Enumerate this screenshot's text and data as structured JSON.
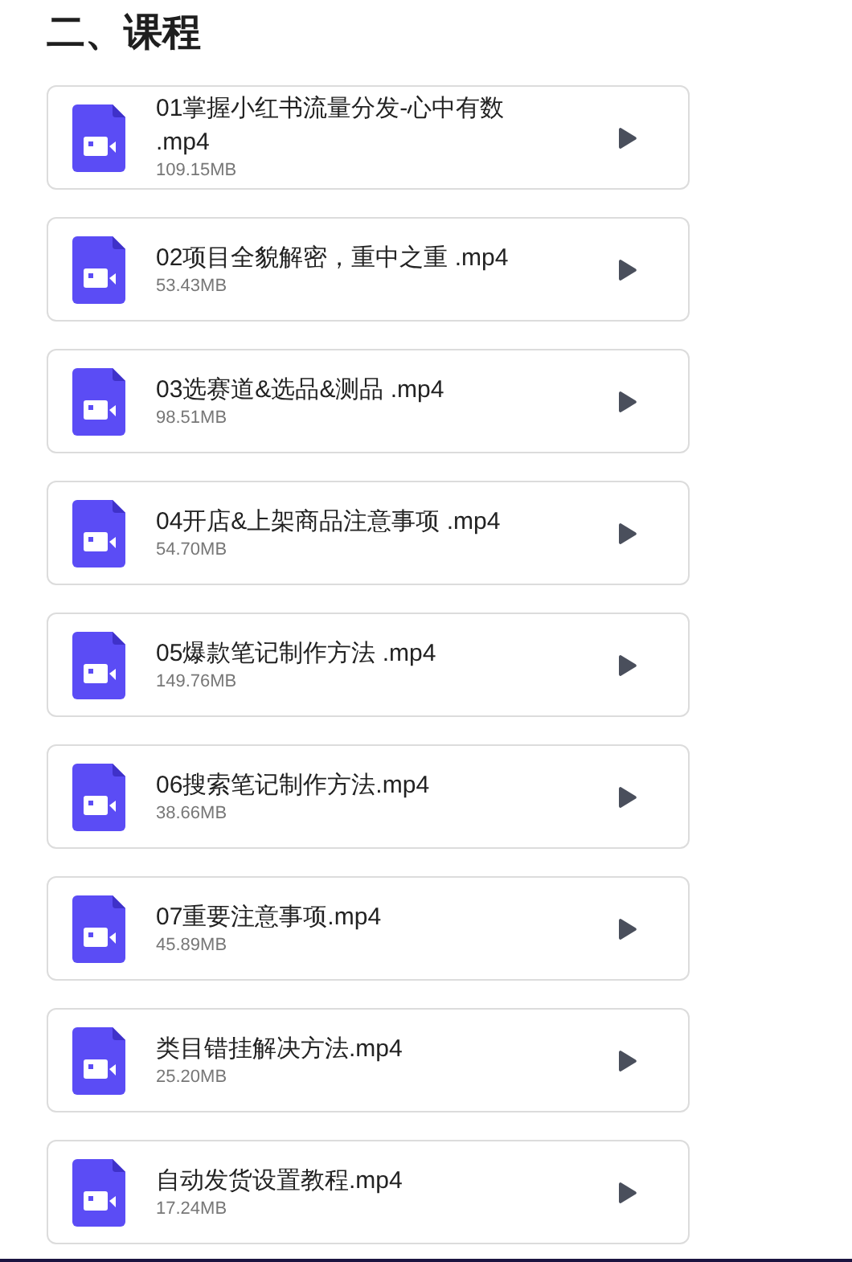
{
  "heading": "二、课程",
  "files": [
    {
      "name": "01掌握小红书流量分发-心中有数 .mp4",
      "size": "109.15MB"
    },
    {
      "name": "02项目全貌解密，重中之重 .mp4",
      "size": "53.43MB"
    },
    {
      "name": "03选赛道&选品&测品 .mp4",
      "size": "98.51MB"
    },
    {
      "name": "04开店&上架商品注意事项 .mp4",
      "size": "54.70MB"
    },
    {
      "name": "05爆款笔记制作方法 .mp4",
      "size": "149.76MB"
    },
    {
      "name": "06搜索笔记制作方法.mp4",
      "size": "38.66MB"
    },
    {
      "name": "07重要注意事项.mp4",
      "size": "45.89MB"
    },
    {
      "name": "类目错挂解决方法.mp4",
      "size": "25.20MB"
    },
    {
      "name": "自动发货设置教程.mp4",
      "size": "17.24MB"
    }
  ]
}
